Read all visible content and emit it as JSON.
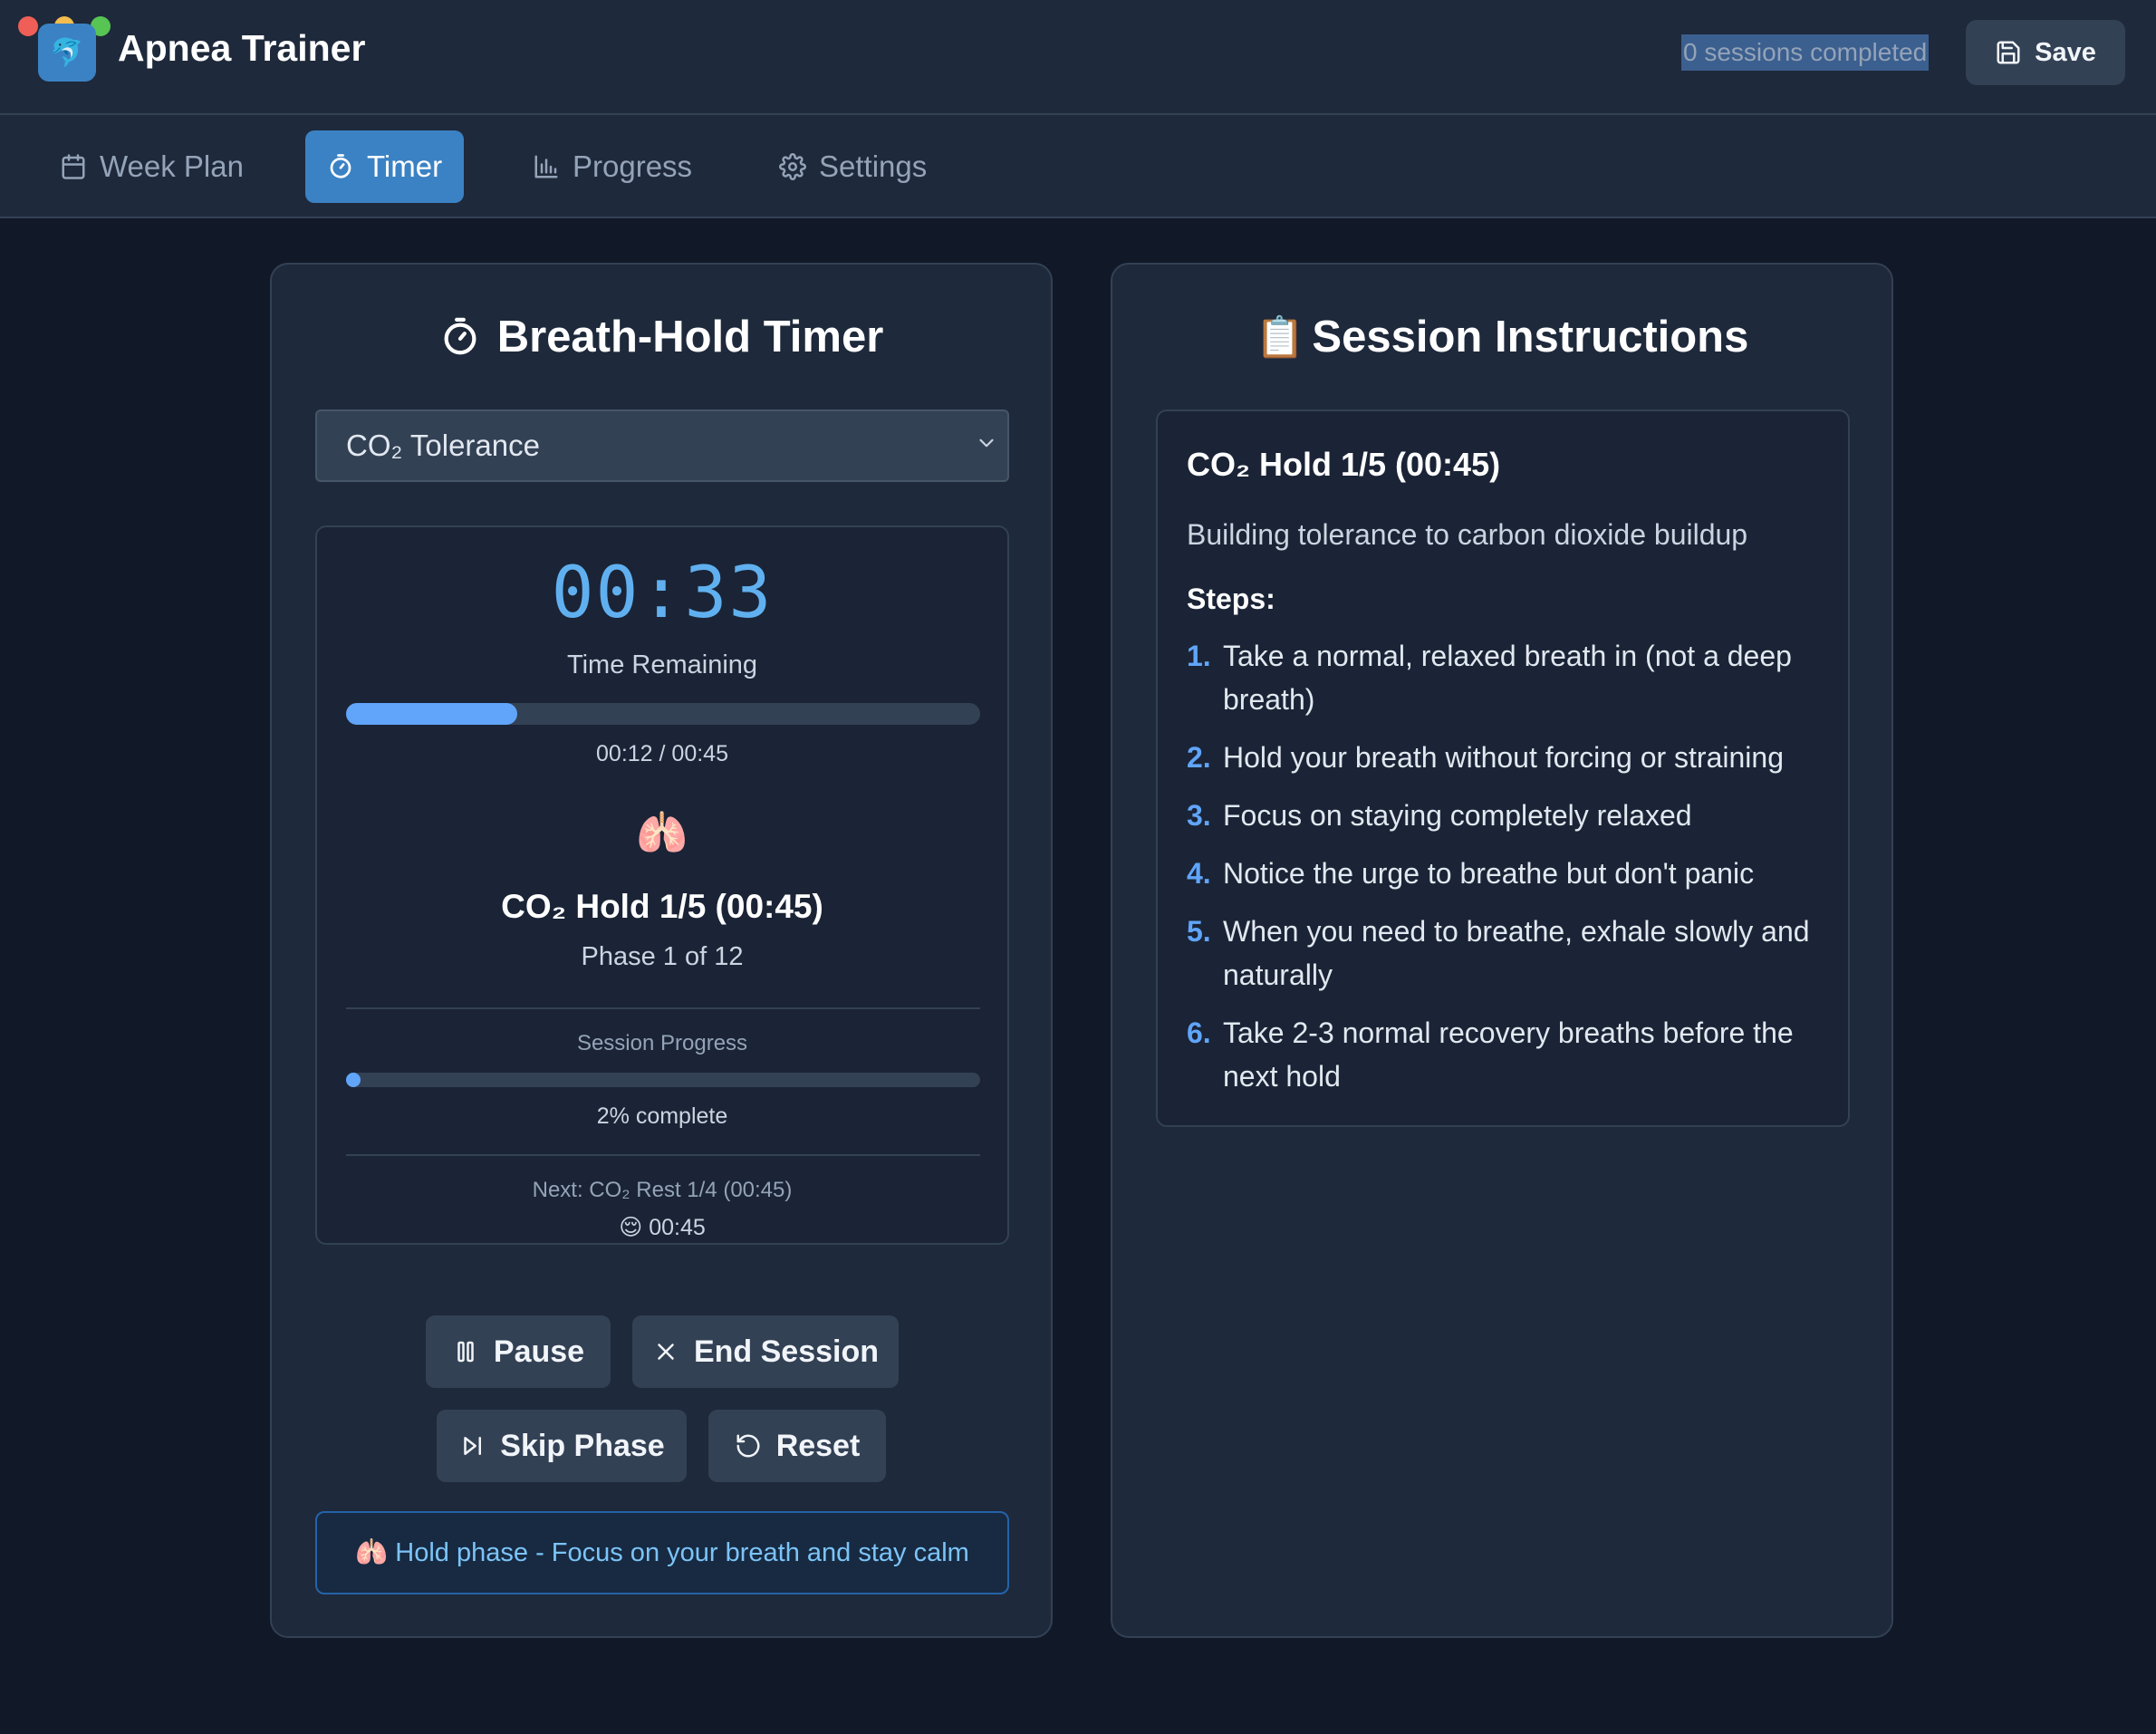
{
  "app": {
    "title": "Apnea Trainer",
    "logo_glyph": "🐬",
    "sessions_completed": "0 sessions completed",
    "save_label": "Save"
  },
  "nav": {
    "tabs": [
      {
        "label": "Week Plan",
        "icon": "calendar-icon",
        "active": false
      },
      {
        "label": "Timer",
        "icon": "stopwatch-icon",
        "active": true
      },
      {
        "label": "Progress",
        "icon": "bar-chart-icon",
        "active": false
      },
      {
        "label": "Settings",
        "icon": "gear-icon",
        "active": false
      }
    ]
  },
  "timer_panel": {
    "title": "Breath-Hold Timer",
    "selected_mode": "CO₂ Tolerance",
    "time_remaining": "00:33",
    "time_remaining_label": "Time Remaining",
    "phase_progress_fraction": 0.27,
    "phase_elapsed": "00:12 / 00:45",
    "phase_glyph": "🫁",
    "phase_name": "CO₂ Hold 1/5 (00:45)",
    "phase_counter": "Phase 1 of 12",
    "session_progress_label": "Session Progress",
    "session_progress_fraction": 0.02,
    "session_progress_text": "2% complete",
    "next_phase": "Next: CO₂ Rest 1/4 (00:45)",
    "next_glyph": "😌",
    "next_duration": "00:45",
    "buttons": {
      "pause": "Pause",
      "end_session": "End Session",
      "skip_phase": "Skip Phase",
      "reset": "Reset"
    },
    "hint_glyph": "🫁",
    "hint": "Hold phase - Focus on your breath and stay calm"
  },
  "instructions_panel": {
    "title_glyph": "📋",
    "title": "Session Instructions",
    "phase_title": "CO₂ Hold 1/5 (00:45)",
    "description": "Building tolerance to carbon dioxide buildup",
    "steps_heading": "Steps:",
    "steps": [
      {
        "num": "1.",
        "text": "Take a normal, relaxed breath in (not a deep breath)"
      },
      {
        "num": "2.",
        "text": "Hold your breath without forcing or straining"
      },
      {
        "num": "3.",
        "text": "Focus on staying completely relaxed"
      },
      {
        "num": "4.",
        "text": "Notice the urge to breathe but don't panic"
      },
      {
        "num": "5.",
        "text": "When you need to breathe, exhale slowly and naturally"
      },
      {
        "num": "6.",
        "text": "Take 2-3 normal recovery breaths before the next hold"
      }
    ]
  },
  "colors": {
    "accent": "#3b82c4",
    "timer_digits": "#60b0f0",
    "background": "#111827",
    "panel": "#1e293b"
  }
}
